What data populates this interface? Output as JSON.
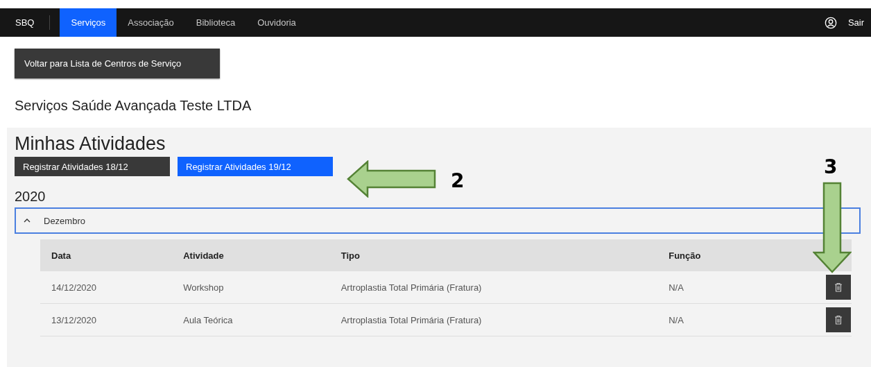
{
  "nav": {
    "logo": "SBQ",
    "tabs": [
      {
        "label": "Serviços",
        "selected": true
      },
      {
        "label": "Associação",
        "selected": false
      },
      {
        "label": "Biblioteca",
        "selected": false
      },
      {
        "label": "Ouvidoria",
        "selected": false
      }
    ],
    "logout": "Sair"
  },
  "back_button": "Voltar para Lista de Centros de Serviço",
  "center_name": "Serviços Saúde Avançada Teste LTDA",
  "activities": {
    "title": "Minhas Atividades",
    "register_buttons": [
      {
        "label": "Registrar Atividades 18/12",
        "selected": false
      },
      {
        "label": "Registrar Atividades 19/12",
        "selected": true
      }
    ],
    "year": "2020",
    "month": {
      "label": "Dezembro",
      "expanded": true
    },
    "table": {
      "columns": [
        "Data",
        "Atividade",
        "Tipo",
        "Função"
      ],
      "rows": [
        [
          "14/12/2020",
          "Workshop",
          "Artroplastia Total Primária (Fratura)",
          "N/A"
        ],
        [
          "13/12/2020",
          "Aula Teórica",
          "Artroplastia Total Primária (Fratura)",
          "N/A"
        ]
      ]
    }
  },
  "annotations": [
    {
      "label": "2",
      "kind": "leftarrow"
    },
    {
      "label": "3",
      "kind": "downarrow"
    }
  ]
}
